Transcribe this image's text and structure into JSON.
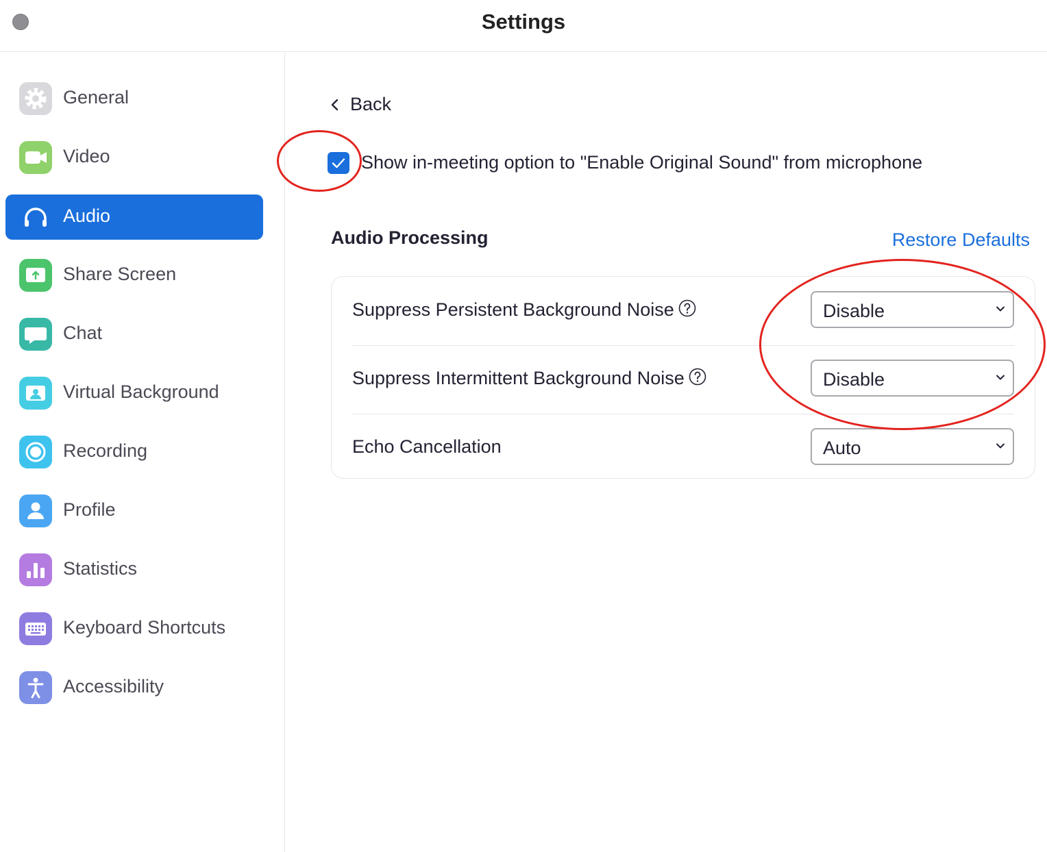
{
  "window": {
    "title": "Settings"
  },
  "sidebar": {
    "items": [
      {
        "label": "General",
        "icon": "gear-icon",
        "color": "#d9d9dd",
        "active": false
      },
      {
        "label": "Video",
        "icon": "video-camera-icon",
        "color": "#8fd16a",
        "active": false
      },
      {
        "label": "Audio",
        "icon": "headphones-icon",
        "color": "#1a6fdc",
        "active": true
      },
      {
        "label": "Share Screen",
        "icon": "share-screen-icon",
        "color": "#4cc46b",
        "active": false
      },
      {
        "label": "Chat",
        "icon": "chat-bubble-icon",
        "color": "#38b9a6",
        "active": false
      },
      {
        "label": "Virtual Background",
        "icon": "virtual-background-icon",
        "color": "#45cde3",
        "active": false
      },
      {
        "label": "Recording",
        "icon": "recording-icon",
        "color": "#3ec3ee",
        "active": false
      },
      {
        "label": "Profile",
        "icon": "profile-icon",
        "color": "#4aa6f2",
        "active": false
      },
      {
        "label": "Statistics",
        "icon": "statistics-icon",
        "color": "#b47ce0",
        "active": false
      },
      {
        "label": "Keyboard Shortcuts",
        "icon": "keyboard-icon",
        "color": "#8f7ce0",
        "active": false
      },
      {
        "label": "Accessibility",
        "icon": "accessibility-icon",
        "color": "#7e8fe6",
        "active": false
      }
    ]
  },
  "main": {
    "back_label": "Back",
    "original_sound": {
      "label": "Show in-meeting option to \"Enable Original Sound\" from microphone",
      "checked": true
    },
    "section_title": "Audio Processing",
    "restore_defaults": "Restore Defaults",
    "rows": [
      {
        "label": "Suppress Persistent Background Noise",
        "has_help": true,
        "value": "Disable"
      },
      {
        "label": "Suppress Intermittent Background Noise",
        "has_help": true,
        "value": "Disable"
      },
      {
        "label": "Echo Cancellation",
        "has_help": false,
        "value": "Auto"
      }
    ]
  },
  "colors": {
    "accent": "#1a6fdc",
    "annotation": "#e3231e"
  }
}
